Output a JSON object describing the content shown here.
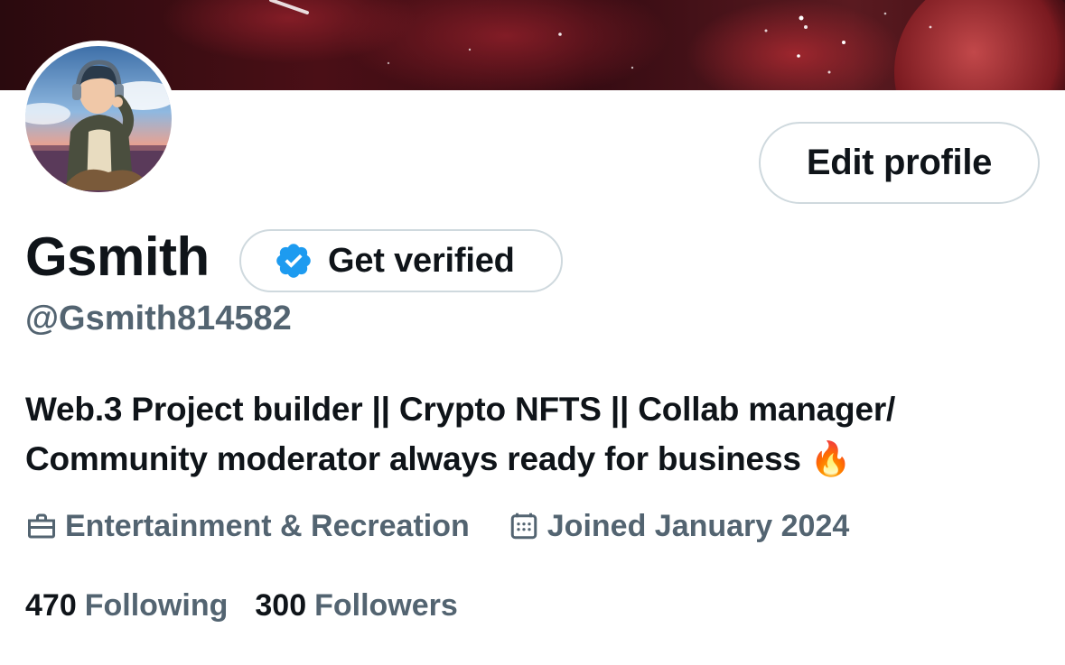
{
  "profile": {
    "name": "Gsmith",
    "handle": "@Gsmith814582",
    "bio_line1": "Web.3 Project builder || Crypto NFTS || Collab manager/",
    "bio_line2": "Community moderator always ready for business",
    "bio_emoji": "🔥",
    "category": "Entertainment & Recreation",
    "joined": "Joined January 2024"
  },
  "actions": {
    "edit_profile_label": "Edit profile",
    "get_verified_label": "Get verified"
  },
  "stats": {
    "following_count": "470",
    "following_label": "Following",
    "followers_count": "300",
    "followers_label": "Followers"
  },
  "icons": {
    "verified": "verified-badge-icon",
    "category": "briefcase-icon",
    "joined": "calendar-icon"
  },
  "colors": {
    "text_primary": "#0f1419",
    "text_secondary": "#536471",
    "border": "#cfd9de",
    "verified_blue": "#1d9bf0"
  }
}
